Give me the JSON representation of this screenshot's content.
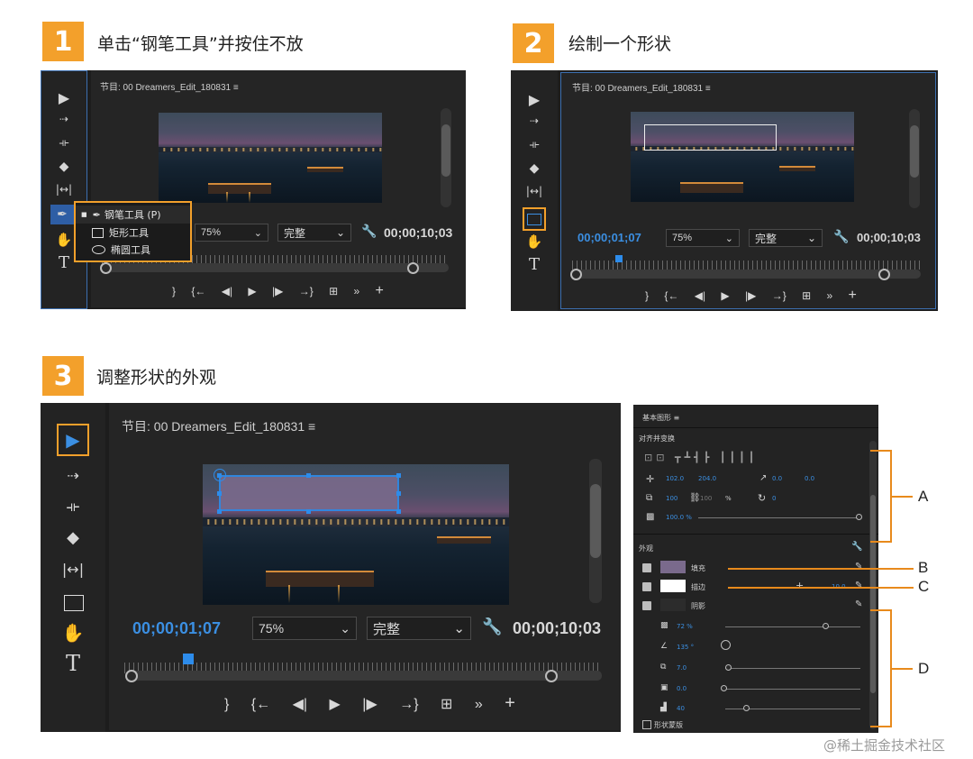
{
  "steps": [
    {
      "number": "1",
      "title": "单击“钢笔工具”并按住不放"
    },
    {
      "number": "2",
      "title": "绘制一个形状"
    },
    {
      "number": "3",
      "title": "调整形状的外观"
    }
  ],
  "monitor": {
    "title": "节目: 00 Dreamers_Edit_180831",
    "menu_icon": "≡",
    "zoom": "75%",
    "quality": "完整",
    "current_tc": "00;00;01;07",
    "duration_tc": "00;00;10;03"
  },
  "tool_menu": {
    "items": [
      {
        "label": "钢笔工具 (P)",
        "icon": "pen-icon",
        "selected": true
      },
      {
        "label": "矩形工具",
        "icon": "rectangle-icon",
        "selected": false
      },
      {
        "label": "椭圆工具",
        "icon": "ellipse-icon",
        "selected": false
      }
    ]
  },
  "tools": [
    "selection-tool-icon",
    "track-select-icon",
    "ripple-edit-icon",
    "razor-icon",
    "slip-icon",
    "pen-icon",
    "hand-icon",
    "type-icon"
  ],
  "transport": [
    "}",
    "{←",
    "◀|",
    "▶",
    "|▶",
    "→}",
    "⊞",
    "»",
    "+"
  ],
  "essential_graphics": {
    "title": "基本图形",
    "menu_icon": "≡",
    "section_align": "对齐并变换",
    "position_x": "102.0",
    "position_y": "204.0",
    "anchor_x": "0.0",
    "anchor_y": "0.0",
    "scale_w": "100",
    "scale_h": "100",
    "scale_unit": "%",
    "rotation": "0",
    "opacity": "100.0 %",
    "section_appearance": "外观",
    "fill_label": "填充",
    "stroke_label": "描边",
    "stroke_width": "10.0",
    "shadow_label": "阴影",
    "shadow_opacity": "72 %",
    "shadow_angle": "135 °",
    "shadow_distance": "7.0",
    "shadow_size": "0.0",
    "shadow_blur": "40",
    "mask_label": "形状蒙版",
    "fill_color": "#7a6a8c",
    "stroke_color": "#ffffff"
  },
  "callouts": [
    "A",
    "B",
    "C",
    "D"
  ],
  "watermark": "@稀土掘金技术社区",
  "colors": {
    "accent": "#f3a02b",
    "timecode_blue": "#3b8fe2",
    "selection_blue": "#2d8ceb"
  }
}
